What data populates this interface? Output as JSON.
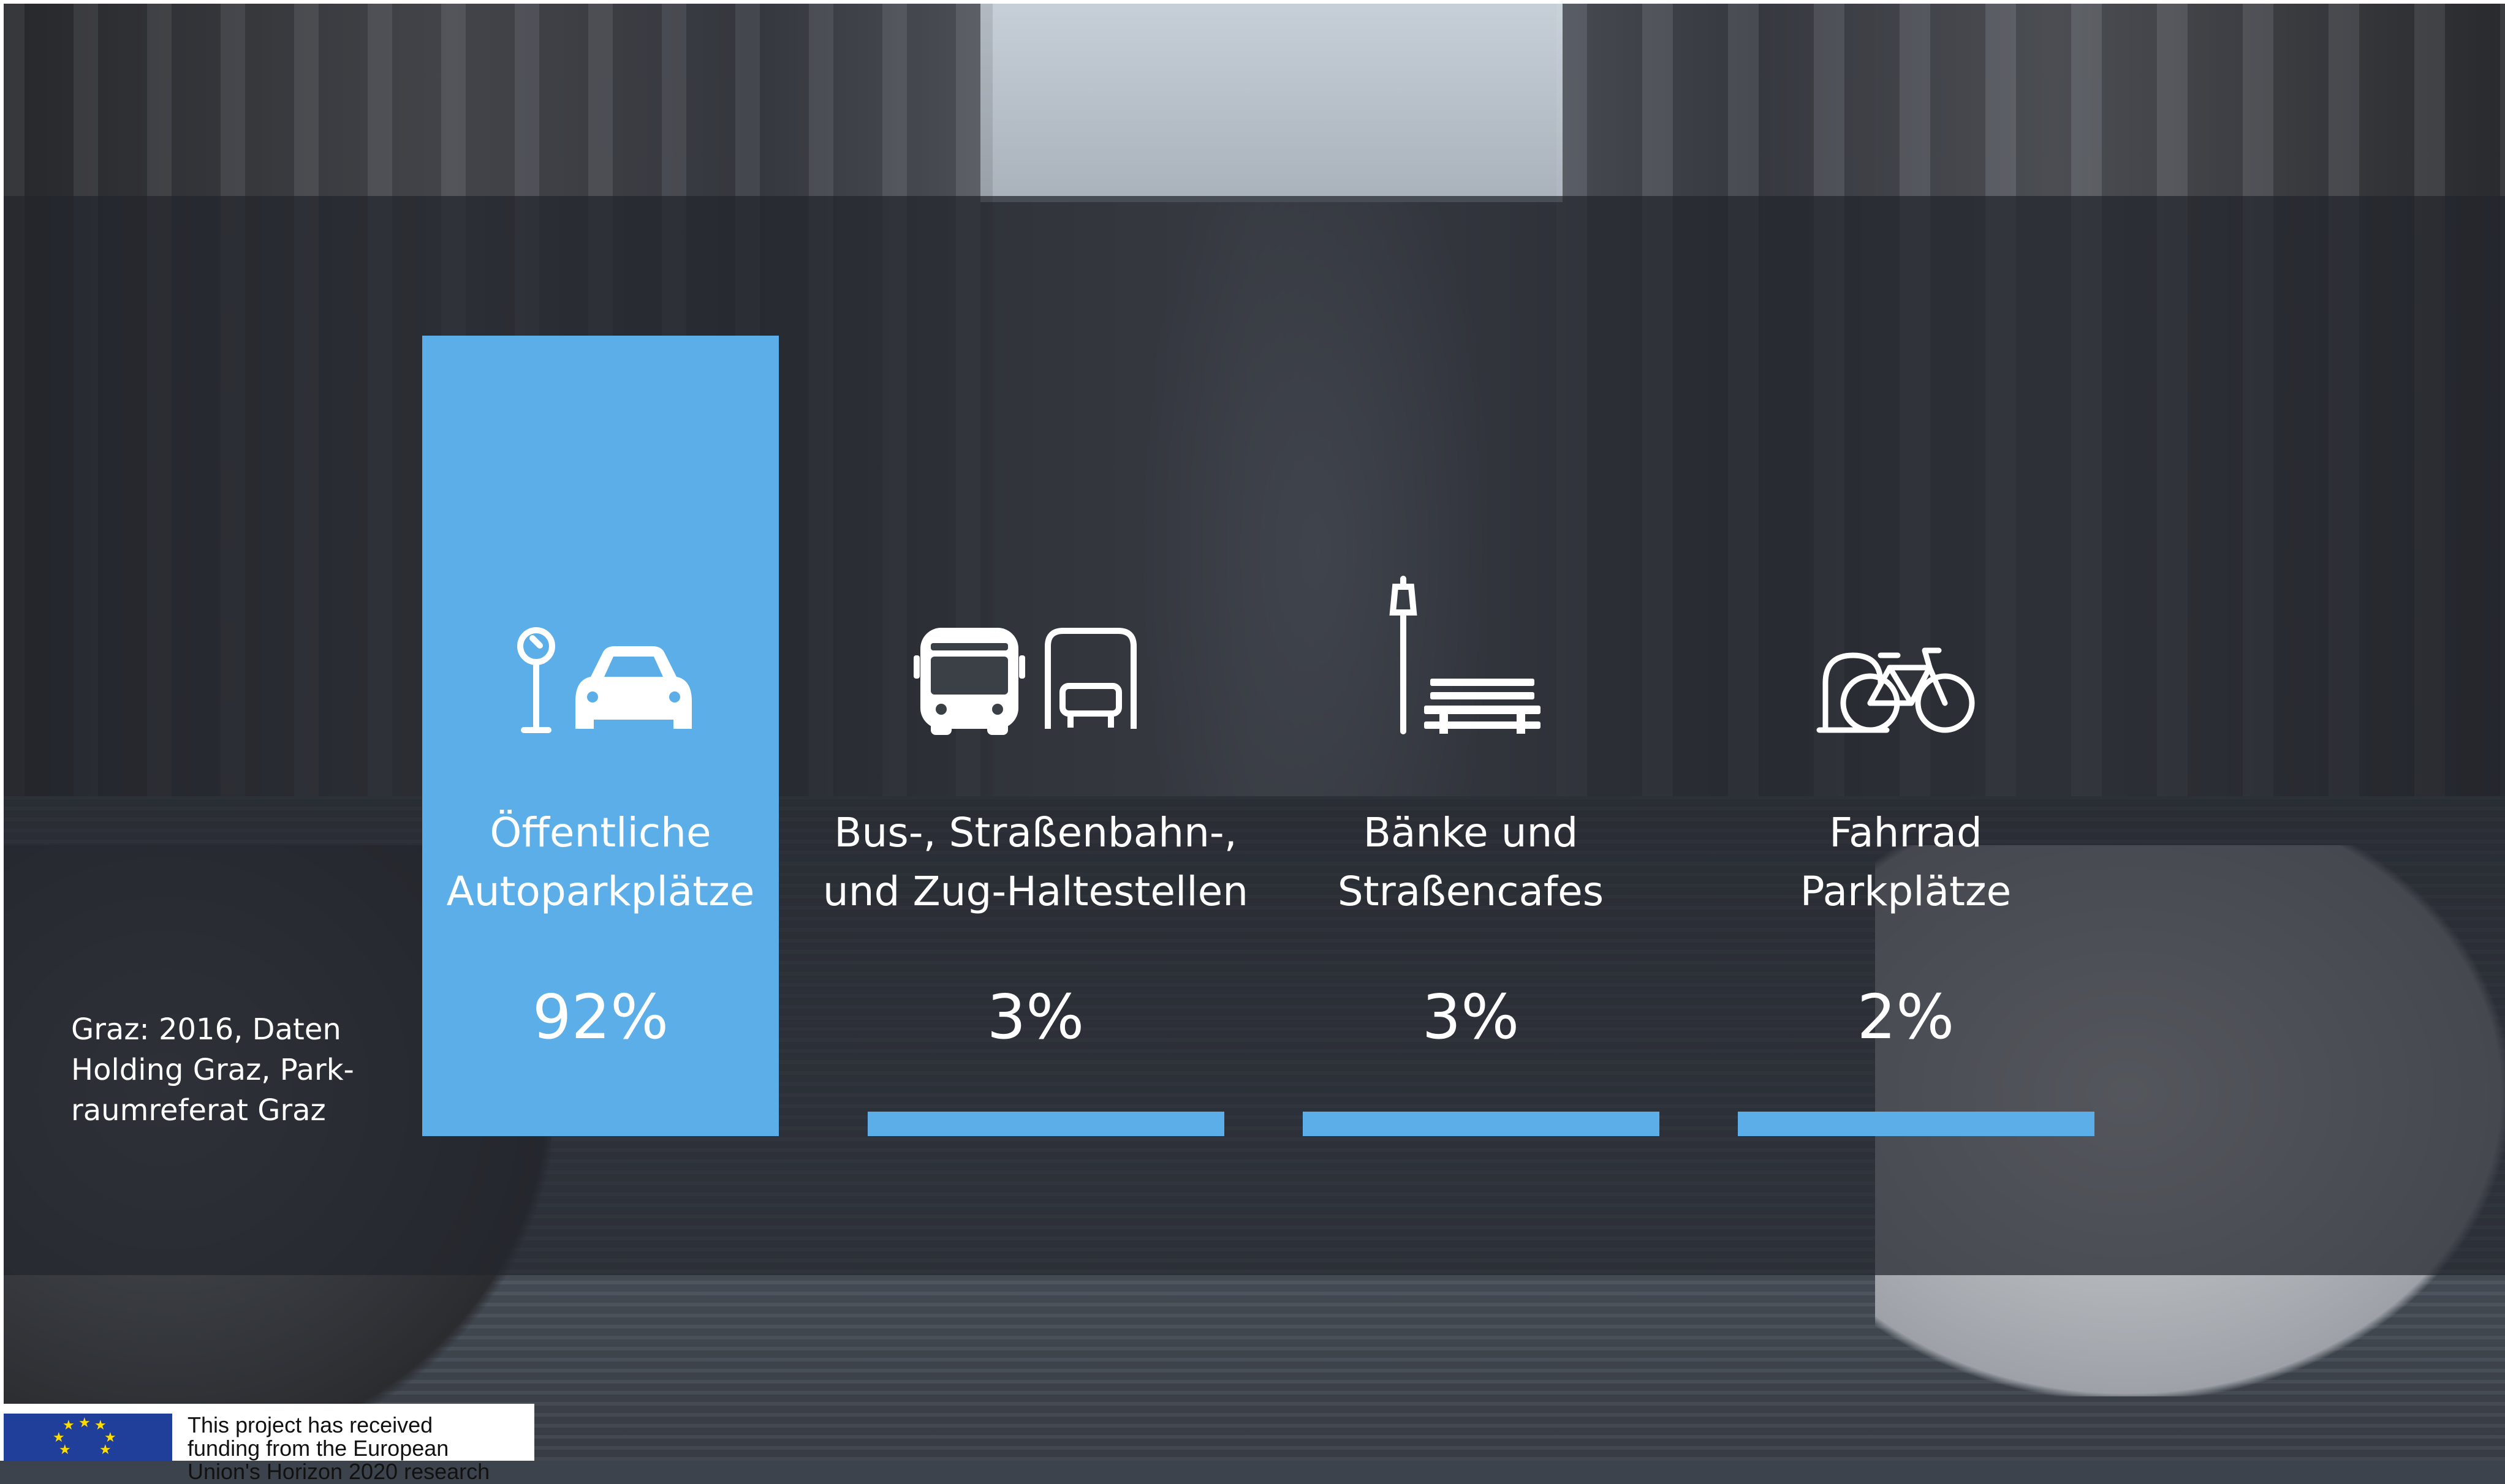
{
  "chart_data": {
    "type": "bar",
    "categories": [
      "Öffentliche\nAutoparkplätze",
      "Bus-, Straßenbahn-,\nund Zug-Haltestellen",
      "Bänke und\nStraßencafes",
      "Fahrrad\nParkplätze"
    ],
    "values": [
      92,
      3,
      3,
      2
    ],
    "value_labels": [
      "92%",
      "3%",
      "3%",
      "2%"
    ],
    "icons": [
      "parking-meter-car-icon",
      "bus-tram-icon",
      "streetlamp-bench-icon",
      "bicycle-parking-icon"
    ],
    "title": "",
    "xlabel": "",
    "ylabel": "",
    "ylim": [
      0,
      92
    ],
    "bar_color": "#5baee8",
    "grid": false
  },
  "source": "Graz: 2016, Daten\nHolding Graz, Park-\nraumreferat Graz",
  "funding": "This project has received\nfunding from the European\nUnion's Horizon 2020 research"
}
